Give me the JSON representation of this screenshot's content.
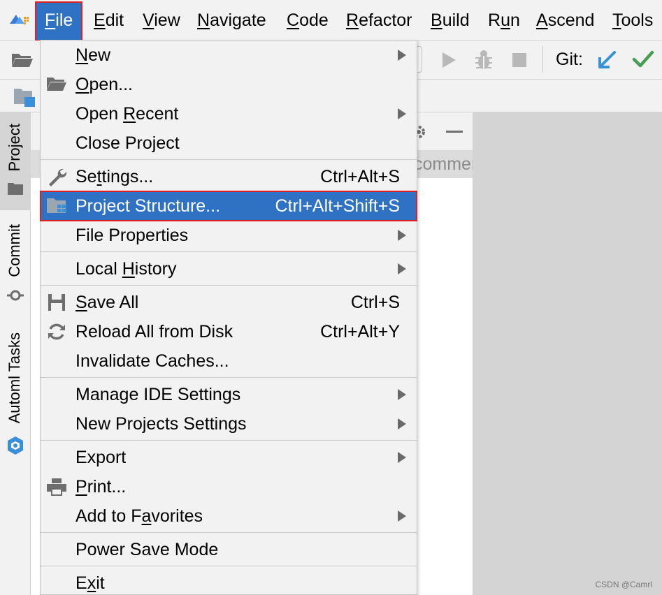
{
  "menubar": {
    "items": [
      {
        "label": "File",
        "mnemonic": "F"
      },
      {
        "label": "Edit",
        "mnemonic": "E"
      },
      {
        "label": "View",
        "mnemonic": "V"
      },
      {
        "label": "Navigate",
        "mnemonic": "N"
      },
      {
        "label": "Code",
        "mnemonic": "C"
      },
      {
        "label": "Refactor",
        "mnemonic": "R"
      },
      {
        "label": "Build",
        "mnemonic": "B"
      },
      {
        "label": "Run",
        "mnemonic": "u"
      },
      {
        "label": "Ascend",
        "mnemonic": "A"
      },
      {
        "label": "Tools",
        "mnemonic": "T"
      }
    ],
    "active": "File"
  },
  "toolbar": {
    "git_label": "Git:",
    "icons": [
      "open-folder-icon",
      "run-icon",
      "debug-icon",
      "stop-icon",
      "git-update-icon",
      "git-commit-icon"
    ]
  },
  "stripe": {
    "tabs": [
      {
        "label": "Project",
        "selected": true
      },
      {
        "label": "Commit",
        "selected": false
      },
      {
        "label": "Automl Tasks",
        "selected": false
      }
    ]
  },
  "project_panel": {
    "subrow_text": "commen"
  },
  "file_menu": {
    "items": [
      {
        "label": "New",
        "underline": 0,
        "icon": "",
        "shortcut": "",
        "submenu": true
      },
      {
        "label": "Open...",
        "underline": 0,
        "icon": "open-folder-icon",
        "shortcut": "",
        "submenu": false
      },
      {
        "label": "Open Recent",
        "underline": 5,
        "icon": "",
        "shortcut": "",
        "submenu": true
      },
      {
        "label": "Close Project",
        "underline": -1,
        "icon": "",
        "shortcut": "",
        "submenu": false,
        "separator_after": true
      },
      {
        "label": "Settings...",
        "underline": 2,
        "icon": "wrench-icon",
        "shortcut": "Ctrl+Alt+S",
        "submenu": false
      },
      {
        "label": "Project Structure...",
        "underline": -1,
        "icon": "project-structure-icon",
        "shortcut": "Ctrl+Alt+Shift+S",
        "submenu": false,
        "highlighted": true
      },
      {
        "label": "File Properties",
        "underline": -1,
        "icon": "",
        "shortcut": "",
        "submenu": true,
        "separator_after": true
      },
      {
        "label": "Local History",
        "underline": 6,
        "icon": "",
        "shortcut": "",
        "submenu": true,
        "separator_after": true
      },
      {
        "label": "Save All",
        "underline": 0,
        "icon": "save-icon",
        "shortcut": "Ctrl+S",
        "submenu": false
      },
      {
        "label": "Reload All from Disk",
        "underline": -1,
        "icon": "reload-icon",
        "shortcut": "Ctrl+Alt+Y",
        "submenu": false
      },
      {
        "label": "Invalidate Caches...",
        "underline": -1,
        "icon": "",
        "shortcut": "",
        "submenu": false,
        "separator_after": true
      },
      {
        "label": "Manage IDE Settings",
        "underline": -1,
        "icon": "",
        "shortcut": "",
        "submenu": true
      },
      {
        "label": "New Projects Settings",
        "underline": -1,
        "icon": "",
        "shortcut": "",
        "submenu": true,
        "separator_after": true
      },
      {
        "label": "Export",
        "underline": -1,
        "icon": "",
        "shortcut": "",
        "submenu": true
      },
      {
        "label": "Print...",
        "underline": 0,
        "icon": "print-icon",
        "shortcut": "",
        "submenu": false
      },
      {
        "label": "Add to Favorites",
        "underline": 8,
        "icon": "",
        "shortcut": "",
        "submenu": true,
        "separator_after": true
      },
      {
        "label": "Power Save Mode",
        "underline": -1,
        "icon": "",
        "shortcut": "",
        "submenu": false,
        "separator_after": true
      },
      {
        "label": "Exit",
        "underline": 1,
        "icon": "",
        "shortcut": "",
        "submenu": false
      }
    ]
  },
  "watermark": "CSDN @Camrl",
  "colors": {
    "highlight": "#2f72c4",
    "focus_outline": "#e02020",
    "git_update": "#3592d4",
    "git_commit": "#499c54"
  }
}
